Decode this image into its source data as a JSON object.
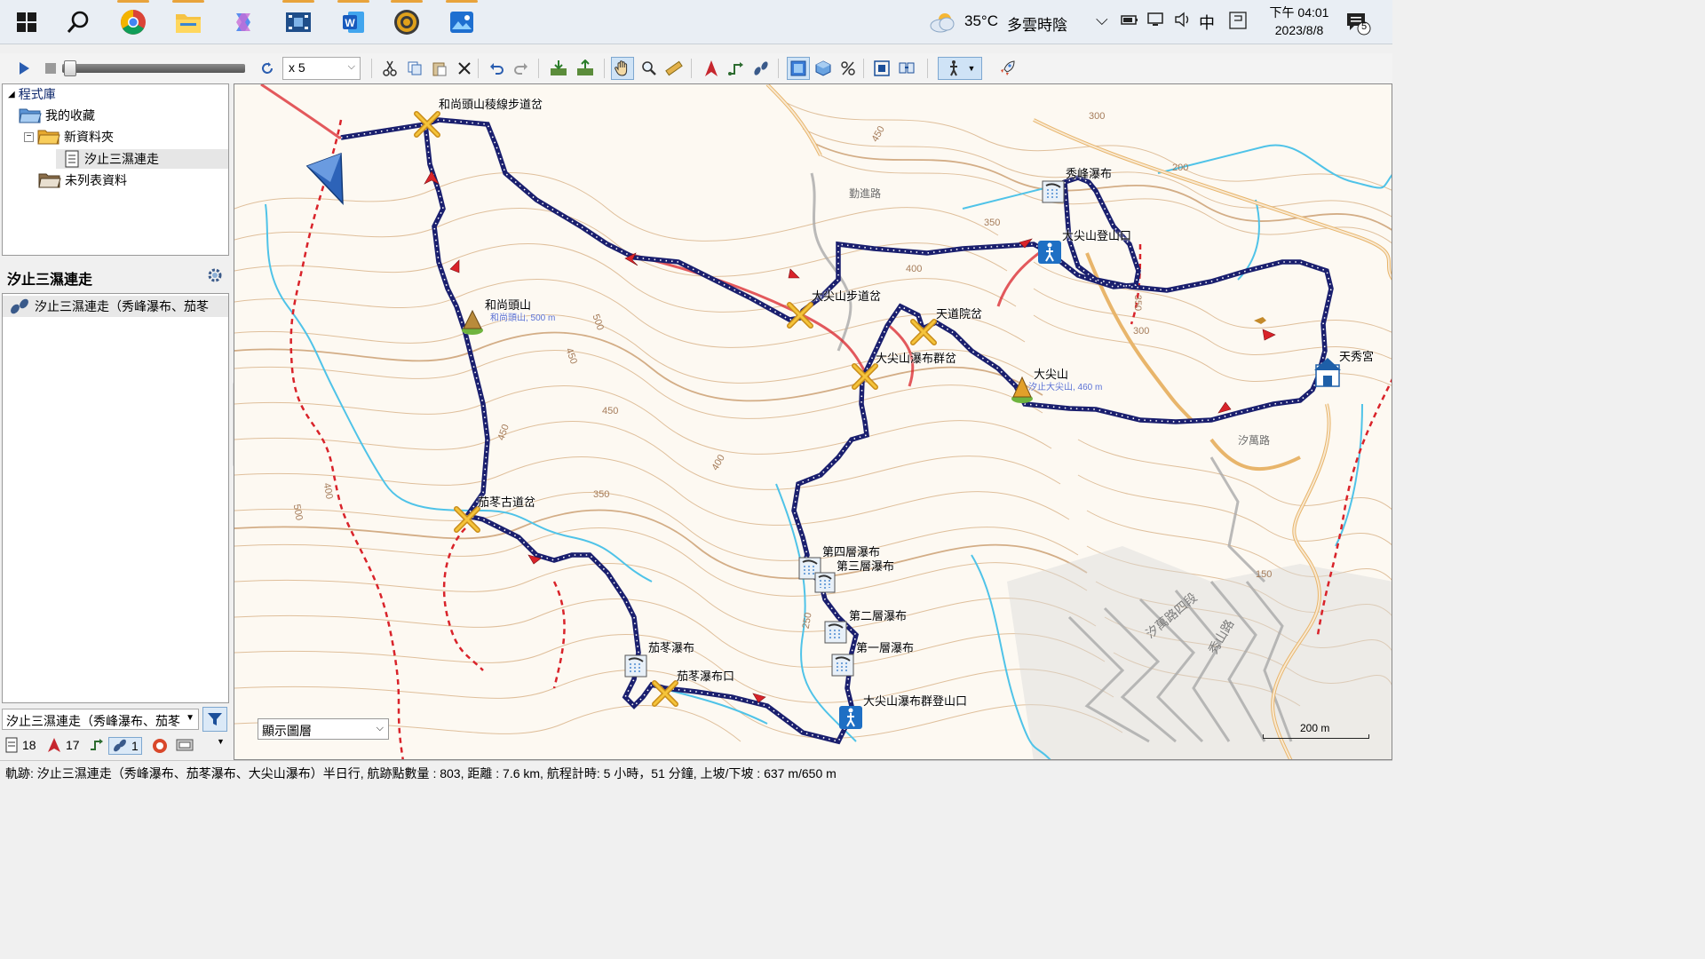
{
  "taskbar": {
    "apps": [
      "start-button",
      "search",
      "chrome",
      "file-explorer",
      "copilot",
      "video-editor",
      "word",
      "basecamp",
      "photos"
    ],
    "weather": {
      "temp": "35°C",
      "condition": "多雲時陰"
    },
    "ime": "中",
    "clock": {
      "time": "下午 04:01",
      "date": "2023/8/8"
    },
    "notifications": "5"
  },
  "toolbar": {
    "speed": "x 5"
  },
  "tree": {
    "root": "程式庫",
    "favorites": "我的收藏",
    "new_folder": "新資料夾",
    "track_item": "汐止三濕連走",
    "unlisted": "未列表資料"
  },
  "detail": {
    "title": "汐止三濕連走",
    "row_label": "汐止三濕連走（秀峰瀑布、茄苳"
  },
  "bottom": {
    "track_select": "汐止三濕連走（秀峰瀑布、茄苳",
    "counts": {
      "waypoints": "18",
      "routes": "17",
      "tracks": "1"
    }
  },
  "map": {
    "layer_select": "顯示圖層",
    "scale": "200 m",
    "labels": {
      "l1": "和尚頭山稜線步道岔",
      "l2": "和尚頭山",
      "l2b": "和尚頭山, 500 m",
      "l3": "秀峰瀑布",
      "l4": "大尖山登山口",
      "l5": "大尖山步道岔",
      "l6": "天道院岔",
      "l7": "大尖山瀑布群岔",
      "l8": "大尖山",
      "l8b": "汐止大尖山, 460 m",
      "l9": "天秀宮",
      "l10": "茄苳古道岔",
      "l11": "第四層瀑布",
      "l12": "第三層瀑布",
      "l13": "第二層瀑布",
      "l14": "第一層瀑布",
      "l15": "茄苳瀑布",
      "l16": "茄苳瀑布口",
      "l17": "大尖山瀑布群登山口",
      "r1": "勤進路",
      "r2": "汐萬路",
      "r3": "秀山路",
      "r4": "汐萬路四段"
    },
    "contours": [
      "300",
      "200",
      "450",
      "350",
      "400",
      "500",
      "450",
      "450",
      "350",
      "400",
      "450",
      "400",
      "500",
      "250",
      "350",
      "300",
      "150"
    ]
  },
  "status": "軌跡: 汐止三濕連走（秀峰瀑布、茄苳瀑布、大尖山瀑布）半日行, 航跡點數量 : 803, 距離 : 7.6 km, 航程計時: 5 小時，51 分鐘, 上坡/下坡 : 637 m/650 m",
  "colors": {
    "track": "#1a1f6e",
    "trail_red": "#d9232a",
    "contour": "#d9b48a",
    "river": "#4fc3e8"
  }
}
